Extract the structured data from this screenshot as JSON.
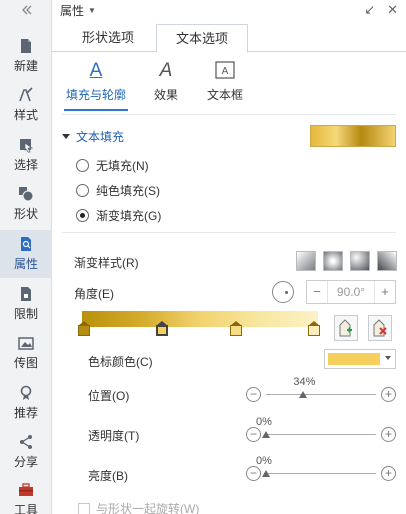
{
  "sidebar": {
    "items": [
      {
        "label": "新建",
        "icon": "new-file-icon"
      },
      {
        "label": "样式",
        "icon": "style-pen-icon"
      },
      {
        "label": "选择",
        "icon": "select-cursor-icon"
      },
      {
        "label": "形状",
        "icon": "shapes-icon"
      },
      {
        "label": "属性",
        "icon": "properties-icon",
        "active": true
      },
      {
        "label": "限制",
        "icon": "restrict-file-icon"
      },
      {
        "label": "传图",
        "icon": "upload-image-icon"
      },
      {
        "label": "推荐",
        "icon": "recommend-icon"
      },
      {
        "label": "分享",
        "icon": "share-icon"
      },
      {
        "label": "工具",
        "icon": "toolbox-icon"
      }
    ]
  },
  "panel": {
    "title": "属性",
    "tabs": [
      "形状选项",
      "文本选项"
    ],
    "active_tab": "文本选项",
    "subtabs": [
      {
        "label": "填充与轮廓",
        "icon": "text-fill-outline-icon",
        "glyph": "A"
      },
      {
        "label": "效果",
        "icon": "text-effect-icon",
        "glyph": "A"
      },
      {
        "label": "文本框",
        "icon": "text-box-icon",
        "glyph": "A"
      }
    ]
  },
  "fill": {
    "section_title": "文本填充",
    "options": [
      "无填充(N)",
      "纯色填充(S)",
      "渐变填充(G)"
    ],
    "selected": "渐变填充(G)",
    "gradient_style_label": "渐变样式(R)",
    "angle_label": "角度(E)",
    "angle_value": "90.0°",
    "stop_color_label": "色标颜色(C)",
    "stop_color": "#f6cf5c",
    "position_label": "位置(O)",
    "position_value": "34%",
    "transparency_label": "透明度(T)",
    "transparency_value": "0%",
    "brightness_label": "亮度(B)",
    "brightness_value": "0%",
    "rotate_label": "与形状一起旋转(W)"
  }
}
